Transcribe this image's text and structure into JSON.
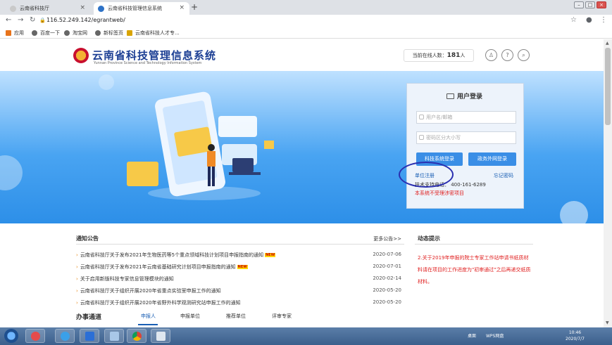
{
  "browser": {
    "tabs": [
      {
        "label": "云南省科技厅",
        "active": false
      },
      {
        "label": "云南省科技管理信息系统",
        "active": true
      }
    ],
    "new_tab": "+",
    "url": "116.52.249.142/egrantweb/",
    "window_controls": [
      "–",
      "□",
      "×"
    ],
    "bookmarks": [
      "应用",
      "百度一下",
      "淘宝网",
      "新标签页",
      "云南省科技人才专..."
    ]
  },
  "header": {
    "title": "云南省科技管理信息系统",
    "subtitle": "Yunnan Province Science and Technology Information System",
    "online_label": "当前在线人数：",
    "online_count": "181",
    "online_unit": "人",
    "icons": [
      "user-icon",
      "help-icon",
      "search-icon"
    ]
  },
  "login": {
    "title": "用户登录",
    "username_placeholder": "用户名/邮箱",
    "password_placeholder": "密码区分大小写",
    "login_button": "科技系统登录",
    "gov_login_button": "政务外网登录",
    "register_link": "单位注册",
    "forgot_link": "忘记密码",
    "support": "技术支持电话：  400-161-6289",
    "warning": "本系统不受理涉密项目"
  },
  "notices": {
    "title": "通知公告",
    "more": "更多公告>>",
    "items": [
      {
        "text": "云南省科技厅关于发布2021年生物医药等5个重点领域科技计划项目申报指南的通知",
        "new": "NEW",
        "date": "2020-07-06"
      },
      {
        "text": "云南省科技厅关于发布2021年云南省基础研究计划项目申报指南的通知",
        "new": "NEW",
        "date": "2020-07-01"
      },
      {
        "text": "关于启用新版科技专家信息管理模块的通知",
        "new": "",
        "date": "2020-02-14"
      },
      {
        "text": "云南省科技厅关于组织开展2020年省重点实验室申报工作的通知",
        "new": "",
        "date": "2020-05-20"
      },
      {
        "text": "云南省科技厅关于组织开展2020年省野外科学观测研究站申报工作的通知",
        "new": "",
        "date": "2020-05-20"
      }
    ]
  },
  "dynamic": {
    "title": "动态提示",
    "text": "2.关于2019年申报的院士专家工作站申请书纸质材料请在项目的工作进度为\"初审通过\"之后再递交纸质材料。"
  },
  "services": {
    "title": "办事通道",
    "tabs": [
      "申报人",
      "申报单位",
      "推荐单位",
      "评审专家"
    ]
  },
  "taskbar": {
    "desktop": "桌面",
    "wps": "WPS网盘",
    "time": "10:46",
    "date": "2020/7/7"
  },
  "colors": {
    "brand_blue": "#1c3f94",
    "button_blue": "#3a8ee6",
    "warning_red": "#e02020",
    "annotation_circle": "#2a2fb0"
  }
}
